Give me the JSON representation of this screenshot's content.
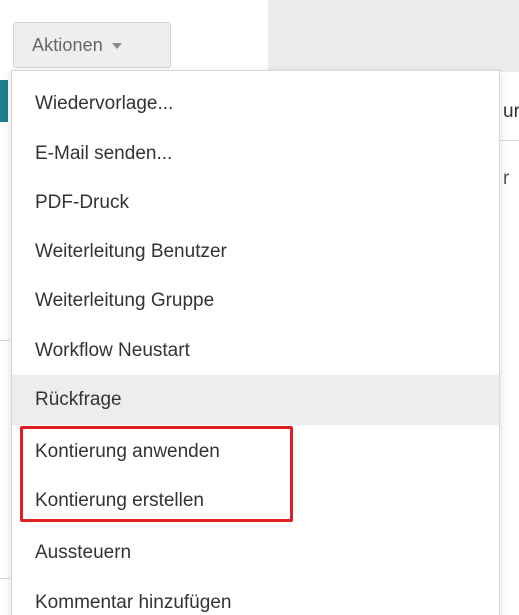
{
  "toolbar": {
    "actions_label": "Aktionen",
    "actions_icon": "caret-down-icon"
  },
  "background": {
    "peek_text_1": "ur",
    "peek_text_2": "r",
    "accent_color": "#1d7f8c"
  },
  "menu": {
    "items": [
      {
        "label": "Wiedervorlage..."
      },
      {
        "label": "E-Mail senden..."
      },
      {
        "label": "PDF-Druck"
      },
      {
        "label": "Weiterleitung Benutzer"
      },
      {
        "label": "Weiterleitung Gruppe"
      },
      {
        "label": "Workflow Neustart"
      },
      {
        "label": "Rückfrage",
        "state": "hovered"
      },
      {
        "label": "Kontierung anwenden",
        "highlighted": true
      },
      {
        "label": "Kontierung erstellen",
        "highlighted": true
      },
      {
        "label": "Aussteuern"
      },
      {
        "label": "Kommentar hinzufügen"
      }
    ]
  },
  "annotation": {
    "highlight_color": "#e02020"
  }
}
